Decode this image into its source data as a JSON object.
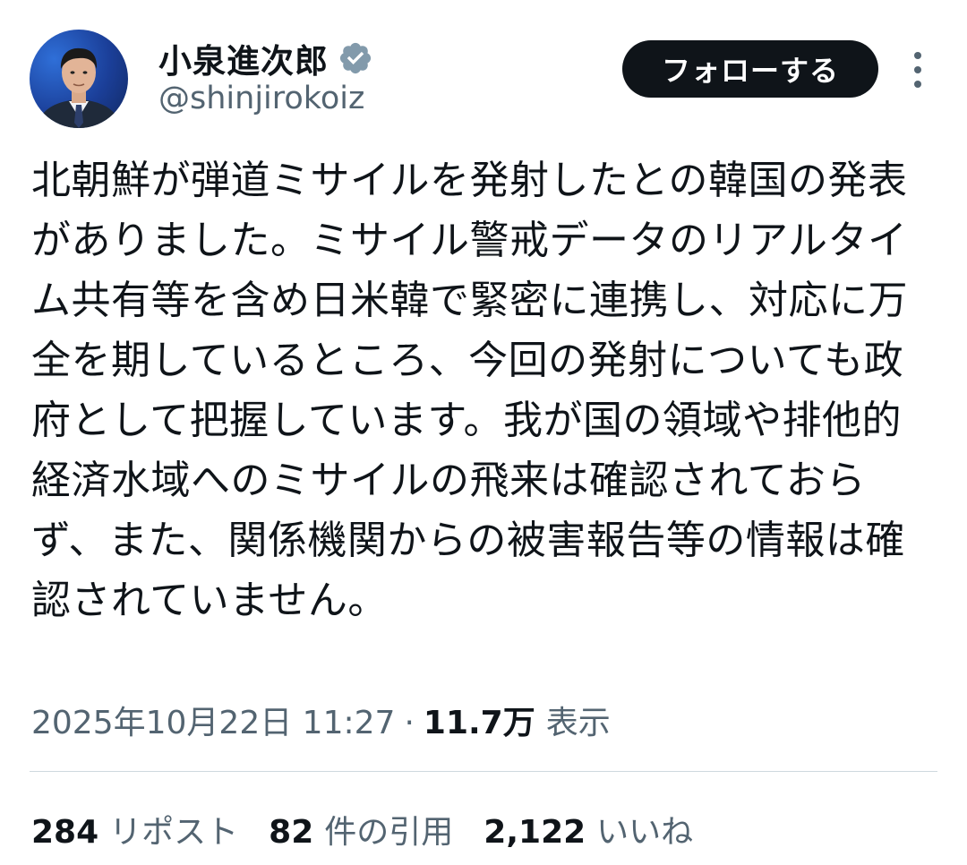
{
  "author": {
    "display_name": "小泉進次郎",
    "handle": "@shinjirokoiz",
    "verified": true,
    "avatar_icon": "profile-photo"
  },
  "actions": {
    "follow_label": "フォローする",
    "more_icon": "more-vertical-icon"
  },
  "tweet": {
    "text": "北朝鮮が弾道ミサイルを発射したとの韓国の発表がありました。ミサイル警戒データのリアルタイム共有等を含め日米韓で緊密に連携し、対応に万全を期しているところ、今回の発射についても政府として把握しています。我が国の領域や排他的経済水域へのミサイルの飛来は確認されておらず、また、関係機関からの被害報告等の情報は確認されていません。",
    "timestamp": "2025年10月22日 11:27",
    "separator": "·",
    "views_count": "11.7万",
    "views_label": "表示"
  },
  "stats": {
    "reposts_count": "284",
    "reposts_label": "リポスト",
    "quotes_count": "82",
    "quotes_label": "件の引用",
    "likes_count": "2,122",
    "likes_label": "いいね"
  },
  "colors": {
    "text": "#0f1419",
    "secondary": "#536471",
    "verified_badge": "#829aab",
    "button_bg": "#0f1419",
    "divider": "#cfd9de"
  }
}
